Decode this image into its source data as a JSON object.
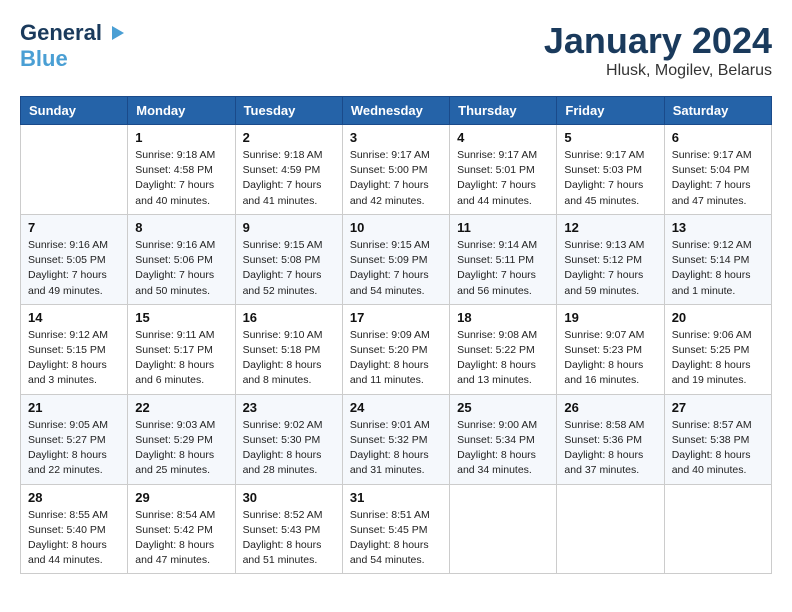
{
  "header": {
    "logo_line1": "General",
    "logo_line2": "Blue",
    "month": "January 2024",
    "location": "Hlusk, Mogilev, Belarus"
  },
  "days_of_week": [
    "Sunday",
    "Monday",
    "Tuesday",
    "Wednesday",
    "Thursday",
    "Friday",
    "Saturday"
  ],
  "weeks": [
    [
      {
        "day": "",
        "sunrise": "",
        "sunset": "",
        "daylight": ""
      },
      {
        "day": "1",
        "sunrise": "Sunrise: 9:18 AM",
        "sunset": "Sunset: 4:58 PM",
        "daylight": "Daylight: 7 hours and 40 minutes."
      },
      {
        "day": "2",
        "sunrise": "Sunrise: 9:18 AM",
        "sunset": "Sunset: 4:59 PM",
        "daylight": "Daylight: 7 hours and 41 minutes."
      },
      {
        "day": "3",
        "sunrise": "Sunrise: 9:17 AM",
        "sunset": "Sunset: 5:00 PM",
        "daylight": "Daylight: 7 hours and 42 minutes."
      },
      {
        "day": "4",
        "sunrise": "Sunrise: 9:17 AM",
        "sunset": "Sunset: 5:01 PM",
        "daylight": "Daylight: 7 hours and 44 minutes."
      },
      {
        "day": "5",
        "sunrise": "Sunrise: 9:17 AM",
        "sunset": "Sunset: 5:03 PM",
        "daylight": "Daylight: 7 hours and 45 minutes."
      },
      {
        "day": "6",
        "sunrise": "Sunrise: 9:17 AM",
        "sunset": "Sunset: 5:04 PM",
        "daylight": "Daylight: 7 hours and 47 minutes."
      }
    ],
    [
      {
        "day": "7",
        "sunrise": "Sunrise: 9:16 AM",
        "sunset": "Sunset: 5:05 PM",
        "daylight": "Daylight: 7 hours and 49 minutes."
      },
      {
        "day": "8",
        "sunrise": "Sunrise: 9:16 AM",
        "sunset": "Sunset: 5:06 PM",
        "daylight": "Daylight: 7 hours and 50 minutes."
      },
      {
        "day": "9",
        "sunrise": "Sunrise: 9:15 AM",
        "sunset": "Sunset: 5:08 PM",
        "daylight": "Daylight: 7 hours and 52 minutes."
      },
      {
        "day": "10",
        "sunrise": "Sunrise: 9:15 AM",
        "sunset": "Sunset: 5:09 PM",
        "daylight": "Daylight: 7 hours and 54 minutes."
      },
      {
        "day": "11",
        "sunrise": "Sunrise: 9:14 AM",
        "sunset": "Sunset: 5:11 PM",
        "daylight": "Daylight: 7 hours and 56 minutes."
      },
      {
        "day": "12",
        "sunrise": "Sunrise: 9:13 AM",
        "sunset": "Sunset: 5:12 PM",
        "daylight": "Daylight: 7 hours and 59 minutes."
      },
      {
        "day": "13",
        "sunrise": "Sunrise: 9:12 AM",
        "sunset": "Sunset: 5:14 PM",
        "daylight": "Daylight: 8 hours and 1 minute."
      }
    ],
    [
      {
        "day": "14",
        "sunrise": "Sunrise: 9:12 AM",
        "sunset": "Sunset: 5:15 PM",
        "daylight": "Daylight: 8 hours and 3 minutes."
      },
      {
        "day": "15",
        "sunrise": "Sunrise: 9:11 AM",
        "sunset": "Sunset: 5:17 PM",
        "daylight": "Daylight: 8 hours and 6 minutes."
      },
      {
        "day": "16",
        "sunrise": "Sunrise: 9:10 AM",
        "sunset": "Sunset: 5:18 PM",
        "daylight": "Daylight: 8 hours and 8 minutes."
      },
      {
        "day": "17",
        "sunrise": "Sunrise: 9:09 AM",
        "sunset": "Sunset: 5:20 PM",
        "daylight": "Daylight: 8 hours and 11 minutes."
      },
      {
        "day": "18",
        "sunrise": "Sunrise: 9:08 AM",
        "sunset": "Sunset: 5:22 PM",
        "daylight": "Daylight: 8 hours and 13 minutes."
      },
      {
        "day": "19",
        "sunrise": "Sunrise: 9:07 AM",
        "sunset": "Sunset: 5:23 PM",
        "daylight": "Daylight: 8 hours and 16 minutes."
      },
      {
        "day": "20",
        "sunrise": "Sunrise: 9:06 AM",
        "sunset": "Sunset: 5:25 PM",
        "daylight": "Daylight: 8 hours and 19 minutes."
      }
    ],
    [
      {
        "day": "21",
        "sunrise": "Sunrise: 9:05 AM",
        "sunset": "Sunset: 5:27 PM",
        "daylight": "Daylight: 8 hours and 22 minutes."
      },
      {
        "day": "22",
        "sunrise": "Sunrise: 9:03 AM",
        "sunset": "Sunset: 5:29 PM",
        "daylight": "Daylight: 8 hours and 25 minutes."
      },
      {
        "day": "23",
        "sunrise": "Sunrise: 9:02 AM",
        "sunset": "Sunset: 5:30 PM",
        "daylight": "Daylight: 8 hours and 28 minutes."
      },
      {
        "day": "24",
        "sunrise": "Sunrise: 9:01 AM",
        "sunset": "Sunset: 5:32 PM",
        "daylight": "Daylight: 8 hours and 31 minutes."
      },
      {
        "day": "25",
        "sunrise": "Sunrise: 9:00 AM",
        "sunset": "Sunset: 5:34 PM",
        "daylight": "Daylight: 8 hours and 34 minutes."
      },
      {
        "day": "26",
        "sunrise": "Sunrise: 8:58 AM",
        "sunset": "Sunset: 5:36 PM",
        "daylight": "Daylight: 8 hours and 37 minutes."
      },
      {
        "day": "27",
        "sunrise": "Sunrise: 8:57 AM",
        "sunset": "Sunset: 5:38 PM",
        "daylight": "Daylight: 8 hours and 40 minutes."
      }
    ],
    [
      {
        "day": "28",
        "sunrise": "Sunrise: 8:55 AM",
        "sunset": "Sunset: 5:40 PM",
        "daylight": "Daylight: 8 hours and 44 minutes."
      },
      {
        "day": "29",
        "sunrise": "Sunrise: 8:54 AM",
        "sunset": "Sunset: 5:42 PM",
        "daylight": "Daylight: 8 hours and 47 minutes."
      },
      {
        "day": "30",
        "sunrise": "Sunrise: 8:52 AM",
        "sunset": "Sunset: 5:43 PM",
        "daylight": "Daylight: 8 hours and 51 minutes."
      },
      {
        "day": "31",
        "sunrise": "Sunrise: 8:51 AM",
        "sunset": "Sunset: 5:45 PM",
        "daylight": "Daylight: 8 hours and 54 minutes."
      },
      {
        "day": "",
        "sunrise": "",
        "sunset": "",
        "daylight": ""
      },
      {
        "day": "",
        "sunrise": "",
        "sunset": "",
        "daylight": ""
      },
      {
        "day": "",
        "sunrise": "",
        "sunset": "",
        "daylight": ""
      }
    ]
  ]
}
